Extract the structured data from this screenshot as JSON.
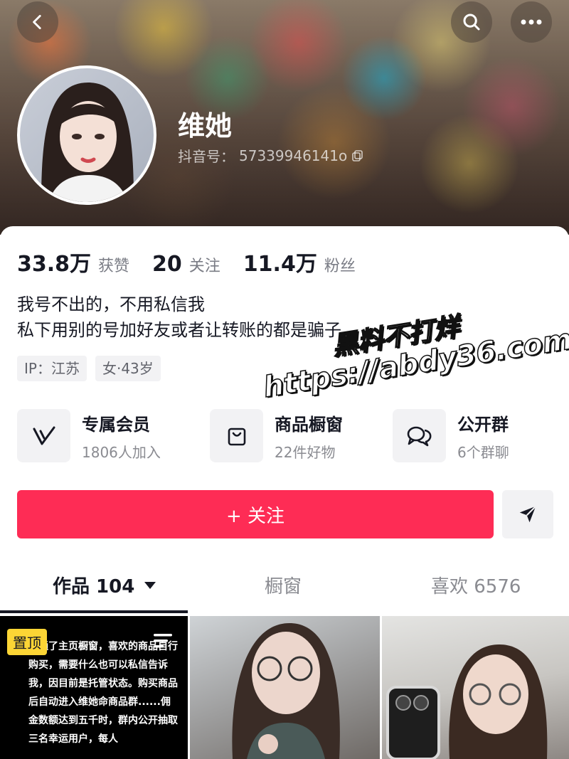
{
  "header": {
    "nickname": "维她",
    "uid_label": "抖音号：",
    "uid": "57339946141o"
  },
  "stats": [
    {
      "value": "33.8万",
      "label": "获赞"
    },
    {
      "value": "20",
      "label": "关注"
    },
    {
      "value": "11.4万",
      "label": "粉丝"
    }
  ],
  "bio": {
    "line1": "我号不出的，不用私信我",
    "line2": "私下用别的号加好友或者让转账的都是骗子"
  },
  "tags": [
    {
      "label": "IP：江苏"
    },
    {
      "label": "女·43岁"
    }
  ],
  "services": [
    {
      "icon": "vip-icon",
      "title": "专属会员",
      "subtitle": "1806人加入"
    },
    {
      "icon": "shopping-bag-icon",
      "title": "商品橱窗",
      "subtitle": "22件好物"
    },
    {
      "icon": "chat-bubbles-icon",
      "title": "公开群",
      "subtitle": "6个群聊"
    }
  ],
  "actions": {
    "follow_label": "+ 关注"
  },
  "tabs": [
    {
      "label": "作品 104"
    },
    {
      "label": "橱窗"
    },
    {
      "label": "喜欢 6576"
    }
  ],
  "posts": {
    "pin_badge": "置顶",
    "pinned_text": "开通了主页橱窗，喜欢的商品自行购买，需要什么也可以私信告诉我，因目前是托管状态。购买商品后自动进入维她命商品群......佣金数额达到五千时，群内公开抽取三名幸运用户，每人"
  },
  "watermark": {
    "title": "黑料不打烊",
    "url": "https://abdy36.com"
  },
  "colors": {
    "accent": "#fe2c55",
    "pin": "#fcd535"
  }
}
